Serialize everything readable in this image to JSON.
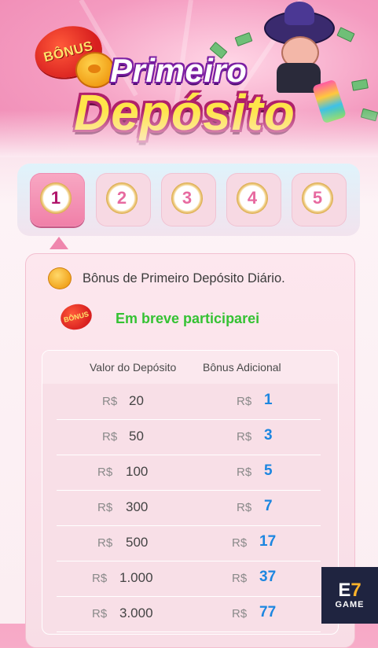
{
  "banner": {
    "badge": "BÔNUS",
    "title_line1": "Primeiro",
    "title_line2": "Depósito"
  },
  "steps": [
    {
      "label": "1",
      "active": true
    },
    {
      "label": "2",
      "active": false
    },
    {
      "label": "3",
      "active": false
    },
    {
      "label": "4",
      "active": false
    },
    {
      "label": "5",
      "active": false
    }
  ],
  "info": {
    "description": "Bônus de Primeiro Depósito Diário.",
    "badge": "BÔNUS",
    "status": "Em breve participarei"
  },
  "table": {
    "col_deposit": "Valor do Depósito",
    "col_bonus": "Bônus Adicional",
    "currency": "R$",
    "rows": [
      {
        "deposit": "20",
        "bonus": "1"
      },
      {
        "deposit": "50",
        "bonus": "3"
      },
      {
        "deposit": "100",
        "bonus": "5"
      },
      {
        "deposit": "300",
        "bonus": "7"
      },
      {
        "deposit": "500",
        "bonus": "17"
      },
      {
        "deposit": "1.000",
        "bonus": "37"
      },
      {
        "deposit": "3.000",
        "bonus": "77"
      }
    ]
  },
  "logo": {
    "brand_e": "E",
    "brand_7": "7",
    "brand_game": "GAME"
  },
  "colors": {
    "accent_pink": "#f07fa8",
    "bonus_blue": "#1c86e0",
    "status_green": "#35c233"
  }
}
